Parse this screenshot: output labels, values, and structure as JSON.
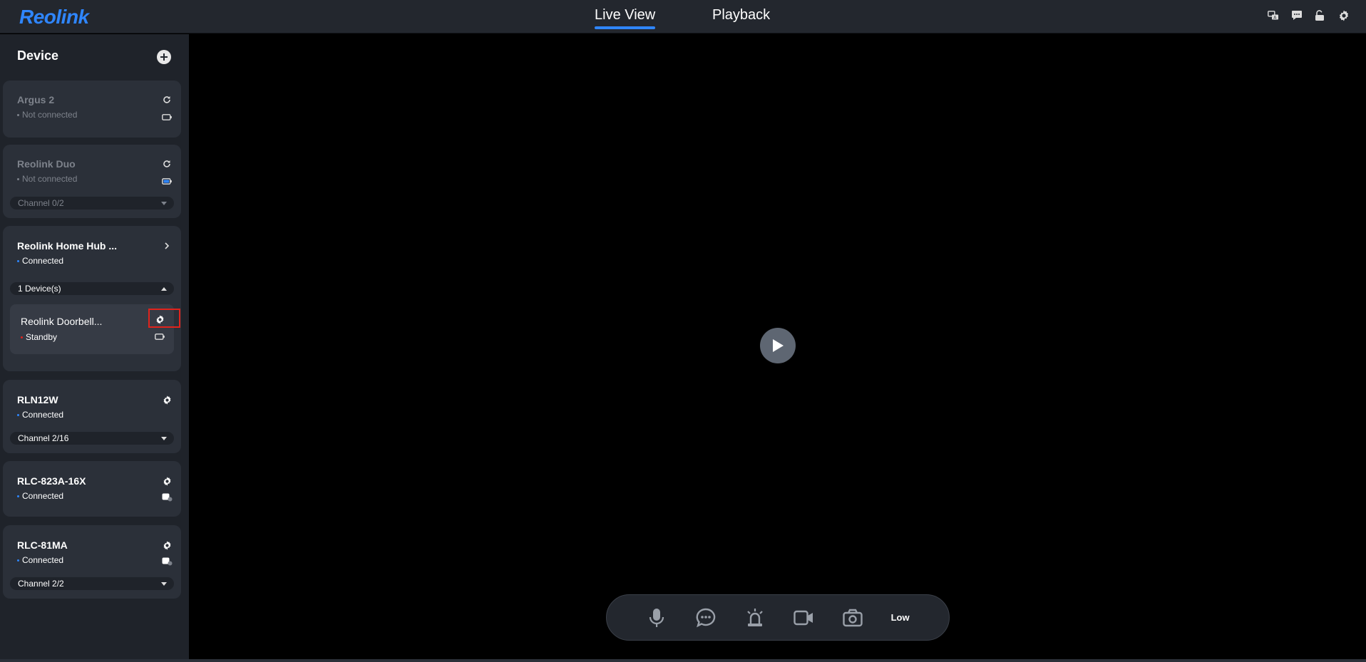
{
  "app": {
    "logo": "Reolink"
  },
  "nav": {
    "tabs": [
      {
        "label": "Live View"
      },
      {
        "label": "Playback"
      }
    ]
  },
  "toolbar": {
    "icons": [
      "translate-icon",
      "message-icon",
      "unlock-icon",
      "gear-icon"
    ]
  },
  "sidebar": {
    "title": "Device",
    "devices": [
      {
        "name": "Argus 2",
        "status": "Not connected",
        "status_color": "#7d828b"
      },
      {
        "name": "Reolink Duo",
        "status": "Not connected",
        "status_color": "#7d828b",
        "channel": "Channel 0/2"
      },
      {
        "name": "Reolink Home Hub ...",
        "status": "Connected",
        "status_color": "#2f86ff",
        "devices_label": "1 Device(s)",
        "sub_device": {
          "name": "Reolink Doorbell...",
          "status": "Standby",
          "status_color": "#e0231c"
        }
      },
      {
        "name": "RLN12W",
        "status": "Connected",
        "status_color": "#2f86ff",
        "channel": "Channel 2/16"
      },
      {
        "name": "RLC-823A-16X",
        "status": "Connected",
        "status_color": "#2f86ff"
      },
      {
        "name": "RLC-81MA",
        "status": "Connected",
        "status_color": "#2f86ff",
        "channel": "Channel 2/2"
      }
    ]
  },
  "controls": {
    "stream_quality": "Low"
  },
  "colors": {
    "accent": "#2f86ff",
    "highlight": "#e0231c"
  }
}
